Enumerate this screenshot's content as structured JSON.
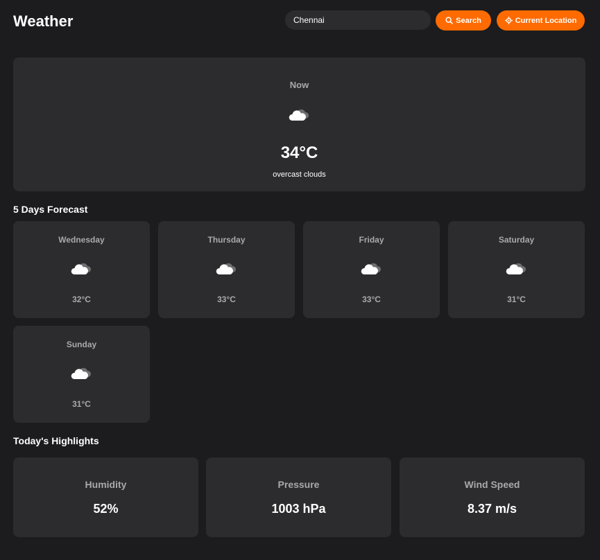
{
  "header": {
    "title": "Weather",
    "search_value": "Chennai",
    "search_button": "Search",
    "location_button": "Current Location",
    "accent_color": "#ff6b00"
  },
  "now": {
    "label": "Now",
    "icon": "overcast-cloud-icon",
    "temperature": "34°C",
    "description": "overcast clouds"
  },
  "forecast": {
    "title": "5 Days Forecast",
    "days": [
      {
        "day": "Wednesday",
        "icon": "overcast-cloud-icon",
        "temperature": "32°C"
      },
      {
        "day": "Thursday",
        "icon": "overcast-cloud-icon",
        "temperature": "33°C"
      },
      {
        "day": "Friday",
        "icon": "overcast-cloud-icon",
        "temperature": "33°C"
      },
      {
        "day": "Saturday",
        "icon": "overcast-cloud-icon",
        "temperature": "31°C"
      },
      {
        "day": "Sunday",
        "icon": "overcast-cloud-icon",
        "temperature": "31°C"
      }
    ]
  },
  "highlights": {
    "title": "Today's Highlights",
    "items": [
      {
        "label": "Humidity",
        "value": "52%"
      },
      {
        "label": "Pressure",
        "value": "1003 hPa"
      },
      {
        "label": "Wind Speed",
        "value": "8.37 m/s"
      }
    ]
  }
}
